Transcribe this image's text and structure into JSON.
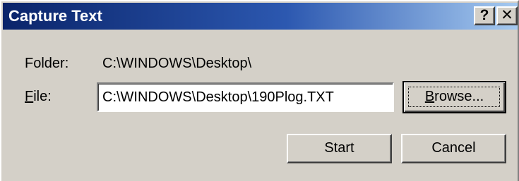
{
  "window": {
    "title": "Capture Text",
    "help_glyph": "?",
    "close_glyph": "✕"
  },
  "folder": {
    "label": "Folder:",
    "value": "C:\\WINDOWS\\Desktop\\"
  },
  "file": {
    "label_accel": "F",
    "label_rest": "ile:",
    "value": "C:\\WINDOWS\\Desktop\\190Plog.TXT"
  },
  "buttons": {
    "browse_accel": "B",
    "browse_rest": "rowse...",
    "start": "Start",
    "cancel": "Cancel"
  },
  "colors": {
    "title_start": "#0a246a",
    "title_end": "#a6caf0",
    "face": "#d4d0c8"
  }
}
